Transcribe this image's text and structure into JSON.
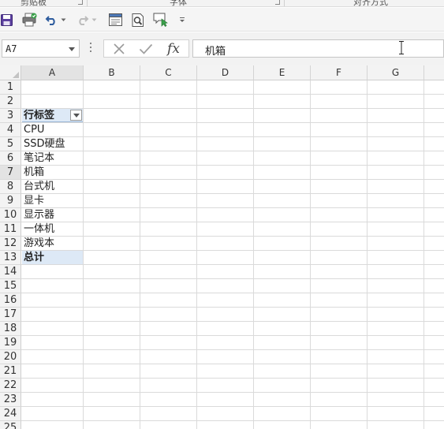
{
  "ribbon_groups": [
    {
      "label": "剪贴板"
    },
    {
      "label": "字体"
    },
    {
      "label": "对齐方式"
    }
  ],
  "quick_access": [
    {
      "icon": "save-icon"
    },
    {
      "icon": "print-icon"
    },
    {
      "icon": "undo-icon"
    },
    {
      "icon": "redo-icon"
    },
    {
      "icon": "print-preview-icon"
    },
    {
      "icon": "zoom-preview-icon"
    },
    {
      "icon": "insert-comment-icon"
    },
    {
      "icon": "customize-toolbar-icon"
    }
  ],
  "formula_bar": {
    "name_box": "A7",
    "fx_label": "fx",
    "value": "机箱"
  },
  "columns": [
    "A",
    "B",
    "C",
    "D",
    "E",
    "F",
    "G"
  ],
  "active_column": "A",
  "rows": [
    "1",
    "2",
    "3",
    "4",
    "5",
    "6",
    "7",
    "8",
    "9",
    "10",
    "11",
    "12",
    "13",
    "14",
    "15",
    "16",
    "17",
    "18",
    "19",
    "20",
    "21",
    "22",
    "23",
    "24",
    "25"
  ],
  "pivot": {
    "header": "行标签",
    "items": [
      "CPU",
      "SSD硬盘",
      "笔记本",
      "机箱",
      "台式机",
      "显卡",
      "显示器",
      "一体机",
      "游戏本"
    ],
    "total": "总计"
  },
  "colors": {
    "accent": "#2e5c9e",
    "selection_fill": "#dde9f6",
    "gridline": "#dadada"
  }
}
